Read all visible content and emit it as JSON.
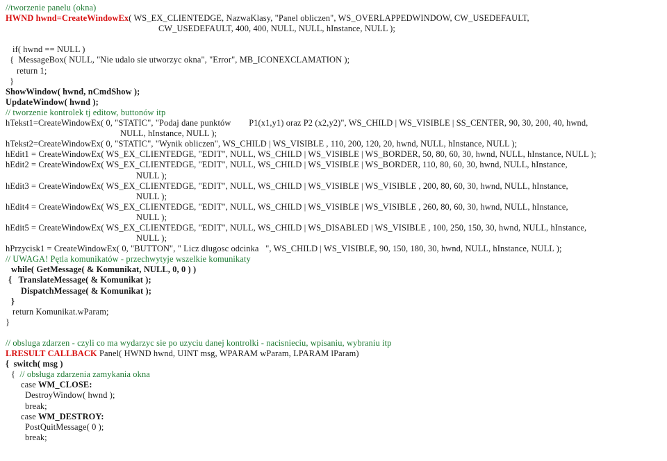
{
  "document": {
    "title": "Win32 API code listing (Polish)",
    "language": "C",
    "colors": {
      "comment": "#1f7a33",
      "keyword": "#d81010",
      "body": "#1a1a1a",
      "background": "#ffffff"
    }
  },
  "lines": [
    {
      "id": "l01",
      "indent": 0,
      "segments": [
        {
          "style": "cmt",
          "text": "//tworzenie panelu (okna)"
        }
      ]
    },
    {
      "id": "l02",
      "indent": 0,
      "segments": [
        {
          "style": "kw",
          "text": "HWND hwnd=CreateWindowEx"
        },
        {
          "style": "plain",
          "text": "( WS_EX_CLIENTEDGE, NazwaKlasy, \"Panel obliczen\", WS_OVERLAPPEDWINDOW, CW_USEDEFAULT,"
        }
      ]
    },
    {
      "id": "l03",
      "indent": 220,
      "segments": [
        {
          "style": "plain",
          "text": "CW_USEDEFAULT, 400, 400, NULL, NULL, hInstance, NULL );"
        }
      ]
    },
    {
      "id": "l04",
      "indent": 0,
      "segments": [
        {
          "style": "plain",
          "text": ""
        }
      ]
    },
    {
      "id": "l05",
      "indent": 10,
      "segments": [
        {
          "style": "plain",
          "text": "if( hwnd == NULL )"
        }
      ]
    },
    {
      "id": "l06",
      "indent": 6,
      "segments": [
        {
          "style": "plain",
          "text": "{  MessageBox( NULL, \"Nie udalo sie utworzyc okna\", \"Error\", MB_ICONEXCLAMATION );"
        }
      ]
    },
    {
      "id": "l07",
      "indent": 16,
      "segments": [
        {
          "style": "plain",
          "text": "return 1;"
        }
      ]
    },
    {
      "id": "l08",
      "indent": 6,
      "segments": [
        {
          "style": "plain",
          "text": "}"
        }
      ]
    },
    {
      "id": "l09",
      "indent": 0,
      "segments": [
        {
          "style": "b",
          "text": "ShowWindow( hwnd, nCmdShow );"
        }
      ]
    },
    {
      "id": "l10",
      "indent": 0,
      "segments": [
        {
          "style": "b",
          "text": "UpdateWindow( hwnd );"
        }
      ]
    },
    {
      "id": "l11",
      "indent": 0,
      "segments": [
        {
          "style": "cmt",
          "text": "// tworzenie kontrolek tj editow, buttonów itp"
        }
      ]
    },
    {
      "id": "l12",
      "indent": 0,
      "segments": [
        {
          "style": "plain",
          "text": "hTekst1=CreateWindowEx( 0, \"STATIC\", \"Podaj dane punktów        P1(x1,y1) oraz P2 (x2,y2)\", WS_CHILD | WS_VISIBLE | SS_CENTER, 90, 30, 200, 40, hwnd,"
        }
      ]
    },
    {
      "id": "l13",
      "indent": 165,
      "segments": [
        {
          "style": "plain",
          "text": "NULL, hInstance, NULL );"
        }
      ]
    },
    {
      "id": "l14",
      "indent": 0,
      "segments": [
        {
          "style": "plain",
          "text": "hTekst2=CreateWindowEx( 0, \"STATIC\", \"Wynik obliczen\", WS_CHILD | WS_VISIBLE , 110, 200, 120, 20, hwnd, NULL, hInstance, NULL );"
        }
      ]
    },
    {
      "id": "l15",
      "indent": 0,
      "segments": [
        {
          "style": "plain",
          "text": "hEdit1 = CreateWindowEx( WS_EX_CLIENTEDGE, \"EDIT\", NULL, WS_CHILD | WS_VISIBLE | WS_BORDER, 50, 80, 60, 30, hwnd, NULL, hInstance, NULL );"
        }
      ]
    },
    {
      "id": "l16",
      "indent": 0,
      "segments": [
        {
          "style": "plain",
          "text": "hEdit2 = CreateWindowEx( WS_EX_CLIENTEDGE, \"EDIT\", NULL, WS_CHILD | WS_VISIBLE | WS_BORDER, 110, 80, 60, 30, hwnd, NULL, hInstance,"
        }
      ]
    },
    {
      "id": "l17",
      "indent": 188,
      "segments": [
        {
          "style": "plain",
          "text": "NULL );"
        }
      ]
    },
    {
      "id": "l18",
      "indent": 0,
      "segments": [
        {
          "style": "plain",
          "text": "hEdit3 = CreateWindowEx( WS_EX_CLIENTEDGE, \"EDIT\", NULL, WS_CHILD | WS_VISIBLE | WS_VISIBLE , 200, 80, 60, 30, hwnd, NULL, hInstance,"
        }
      ]
    },
    {
      "id": "l19",
      "indent": 188,
      "segments": [
        {
          "style": "plain",
          "text": "NULL );"
        }
      ]
    },
    {
      "id": "l20",
      "indent": 0,
      "segments": [
        {
          "style": "plain",
          "text": "hEdit4 = CreateWindowEx( WS_EX_CLIENTEDGE, \"EDIT\", NULL, WS_CHILD | WS_VISIBLE | WS_VISIBLE , 260, 80, 60, 30, hwnd, NULL, hInstance,"
        }
      ]
    },
    {
      "id": "l21",
      "indent": 188,
      "segments": [
        {
          "style": "plain",
          "text": "NULL );"
        }
      ]
    },
    {
      "id": "l22",
      "indent": 0,
      "segments": [
        {
          "style": "plain",
          "text": "hEdit5 = CreateWindowEx( WS_EX_CLIENTEDGE, \"EDIT\", NULL, WS_CHILD | WS_DISABLED | WS_VISIBLE , 100, 250, 150, 30, hwnd, NULL, hInstance,"
        }
      ]
    },
    {
      "id": "l23",
      "indent": 188,
      "segments": [
        {
          "style": "plain",
          "text": "NULL );"
        }
      ]
    },
    {
      "id": "l24",
      "indent": 0,
      "segments": [
        {
          "style": "plain",
          "text": "hPrzycisk1 = CreateWindowEx( 0, \"BUTTON\", \" Licz dlugosc odcinka   \", WS_CHILD | WS_VISIBLE, 90, 150, 180, 30, hwnd, NULL, hInstance, NULL );"
        }
      ]
    },
    {
      "id": "l25",
      "indent": 0,
      "segments": [
        {
          "style": "cmt",
          "text": "// UWAGA! Pętla komunikatów - przechwytyje wszelkie komunikaty"
        }
      ]
    },
    {
      "id": "l26",
      "indent": 8,
      "segments": [
        {
          "style": "b",
          "text": "while( GetMessage( & Komunikat, NULL, 0, 0 ) )"
        }
      ]
    },
    {
      "id": "l27",
      "indent": 4,
      "segments": [
        {
          "style": "b",
          "text": "{   TranslateMessage( & Komunikat );"
        }
      ]
    },
    {
      "id": "l28",
      "indent": 22,
      "segments": [
        {
          "style": "b",
          "text": "DispatchMessage( & Komunikat );"
        }
      ]
    },
    {
      "id": "l29",
      "indent": 8,
      "segments": [
        {
          "style": "b",
          "text": "}"
        }
      ]
    },
    {
      "id": "l30",
      "indent": 10,
      "segments": [
        {
          "style": "plain",
          "text": "return Komunikat.wParam;"
        }
      ]
    },
    {
      "id": "l31",
      "indent": 0,
      "segments": [
        {
          "style": "plain",
          "text": "}"
        }
      ]
    },
    {
      "id": "l32",
      "indent": 0,
      "segments": [
        {
          "style": "plain",
          "text": ""
        }
      ]
    },
    {
      "id": "l33",
      "indent": 0,
      "segments": [
        {
          "style": "cmt",
          "text": "// obsluga zdarzen - czyli co ma wydarzyc sie po uzyciu danej kontrolki - nacisnieciu, wpisaniu, wybraniu itp"
        }
      ]
    },
    {
      "id": "l34",
      "indent": 0,
      "segments": [
        {
          "style": "kw",
          "text": "LRESULT CALLBACK"
        },
        {
          "style": "plain",
          "text": " Panel( HWND hwnd, UINT msg, WPARAM wParam, LPARAM lParam)"
        }
      ]
    },
    {
      "id": "l35",
      "indent": 0,
      "segments": [
        {
          "style": "b",
          "text": "{  switch( msg )"
        }
      ]
    },
    {
      "id": "l36",
      "indent": 8,
      "segments": [
        {
          "style": "plain",
          "text": "{  "
        },
        {
          "style": "cmt",
          "text": "// obsługa zdarzenia zamykania okna"
        }
      ]
    },
    {
      "id": "l37",
      "indent": 22,
      "segments": [
        {
          "style": "plain",
          "text": "case "
        },
        {
          "style": "b",
          "text": "WM_CLOSE:"
        }
      ]
    },
    {
      "id": "l38",
      "indent": 28,
      "segments": [
        {
          "style": "plain",
          "text": "DestroyWindow( hwnd );"
        }
      ]
    },
    {
      "id": "l39",
      "indent": 28,
      "segments": [
        {
          "style": "plain",
          "text": "break;"
        }
      ]
    },
    {
      "id": "l40",
      "indent": 22,
      "segments": [
        {
          "style": "plain",
          "text": "case "
        },
        {
          "style": "b",
          "text": "WM_DESTROY:"
        }
      ]
    },
    {
      "id": "l41",
      "indent": 28,
      "segments": [
        {
          "style": "plain",
          "text": "PostQuitMessage( 0 );"
        }
      ]
    },
    {
      "id": "l42",
      "indent": 28,
      "segments": [
        {
          "style": "plain",
          "text": "break;"
        }
      ]
    }
  ]
}
